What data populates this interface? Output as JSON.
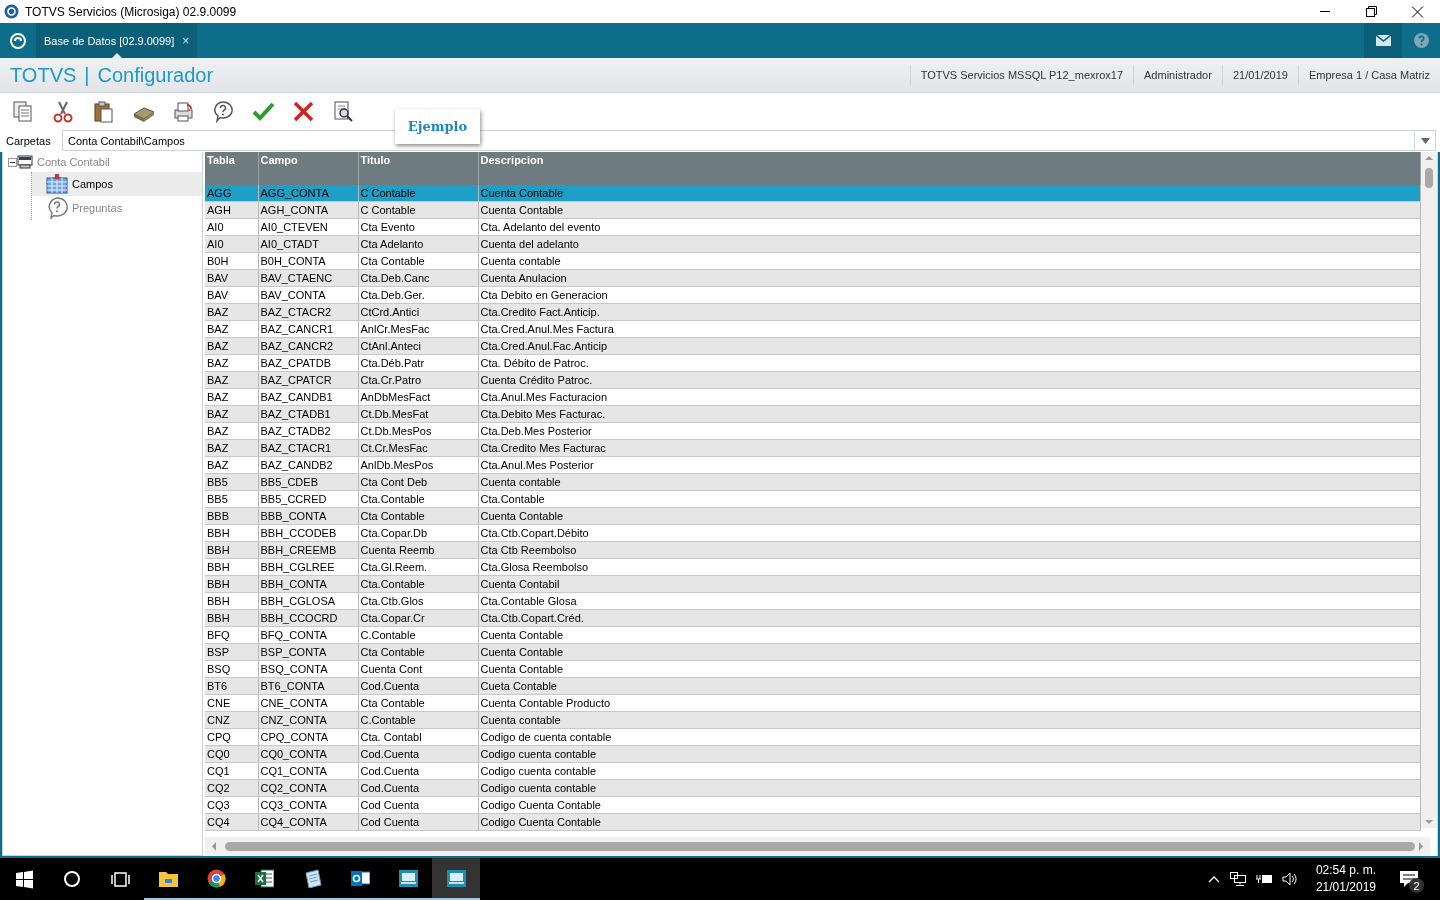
{
  "window": {
    "title": "TOTVS Servicios (Microsiga) 02.9.0099"
  },
  "tabs": [
    {
      "label": "Base de Datos [02.9.0099]",
      "close": "×",
      "selected": true
    }
  ],
  "header": {
    "product": "TOTVS",
    "module": "Configurador",
    "separator": "|",
    "info": [
      "TOTVS Servicios MSSQL P12_mexrox17",
      "Administrador",
      "21/01/2019",
      "Empresa 1 / Casa Matriz"
    ]
  },
  "tooltip": "Ejemplo",
  "folder": {
    "label": "Carpetas",
    "value": "Conta Contabil\\Campos"
  },
  "tree": [
    {
      "label": "Conta Contabil",
      "kind": "table",
      "selected": false,
      "expanded": true,
      "children": [
        {
          "label": "Campos",
          "kind": "grid",
          "selected": true
        },
        {
          "label": "Preguntas",
          "kind": "question",
          "selected": false
        }
      ]
    }
  ],
  "table": {
    "columns": [
      "Tabla",
      "Campo",
      "Titulo",
      "Descripcion"
    ],
    "rows": [
      {
        "cells": [
          "AGG",
          "AGG_CONTA",
          "C Contable",
          "Cuenta Contable"
        ],
        "selected": true
      },
      {
        "cells": [
          "AGH",
          "AGH_CONTA",
          "C Contable",
          "Cuenta Contable"
        ],
        "selected": false
      },
      {
        "cells": [
          "AI0",
          "AI0_CTEVEN",
          "Cta Evento",
          "Cta. Adelanto del evento"
        ],
        "selected": false
      },
      {
        "cells": [
          "AI0",
          "AI0_CTADT",
          "Cta Adelanto",
          "Cuenta del adelanto"
        ],
        "selected": false
      },
      {
        "cells": [
          "B0H",
          "B0H_CONTA",
          "Cta Contable",
          "Cuenta contable"
        ],
        "selected": false
      },
      {
        "cells": [
          "BAV",
          "BAV_CTAENC",
          "Cta.Deb.Canc",
          "Cuenta Anulacion"
        ],
        "selected": false
      },
      {
        "cells": [
          "BAV",
          "BAV_CONTA",
          "Cta.Deb.Ger.",
          "Cta Debito en Generacion"
        ],
        "selected": false
      },
      {
        "cells": [
          "BAZ",
          "BAZ_CTACR2",
          "CtCrd.Antici",
          "Cta.Credito Fact.Anticip."
        ],
        "selected": false
      },
      {
        "cells": [
          "BAZ",
          "BAZ_CANCR1",
          "AnlCr.MesFac",
          "Cta.Cred.Anul.Mes Factura"
        ],
        "selected": false
      },
      {
        "cells": [
          "BAZ",
          "BAZ_CANCR2",
          "CtAnl.Anteci",
          "Cta.Cred.Anul.Fac.Anticip"
        ],
        "selected": false
      },
      {
        "cells": [
          "BAZ",
          "BAZ_CPATDB",
          "Cta.Déb.Patr",
          "Cta. Débito de Patroc."
        ],
        "selected": false
      },
      {
        "cells": [
          "BAZ",
          "BAZ_CPATCR",
          "Cta.Cr.Patro",
          "Cuenta Crédito Patroc."
        ],
        "selected": false
      },
      {
        "cells": [
          "BAZ",
          "BAZ_CANDB1",
          "AnDbMesFact",
          "Cta.Anul.Mes Facturacion"
        ],
        "selected": false
      },
      {
        "cells": [
          "BAZ",
          "BAZ_CTADB1",
          "Ct.Db.MesFat",
          "Cta.Debito Mes Facturac."
        ],
        "selected": false
      },
      {
        "cells": [
          "BAZ",
          "BAZ_CTADB2",
          "Ct.Db.MesPos",
          "Cta.Deb.Mes Posterior"
        ],
        "selected": false
      },
      {
        "cells": [
          "BAZ",
          "BAZ_CTACR1",
          "Ct.Cr.MesFac",
          "Cta.Credito Mes Facturac"
        ],
        "selected": false
      },
      {
        "cells": [
          "BAZ",
          "BAZ_CANDB2",
          "AnlDb.MesPos",
          "Cta.Anul.Mes Posterior"
        ],
        "selected": false
      },
      {
        "cells": [
          "BB5",
          "BB5_CDEB",
          "Cta Cont Deb",
          "Cuenta contable"
        ],
        "selected": false
      },
      {
        "cells": [
          "BB5",
          "BB5_CCRED",
          "Cta.Contable",
          "Cta.Contable"
        ],
        "selected": false
      },
      {
        "cells": [
          "BBB",
          "BBB_CONTA",
          "Cta Contable",
          "Cuenta Contable"
        ],
        "selected": false
      },
      {
        "cells": [
          "BBH",
          "BBH_CCODEB",
          "Cta.Copar.Db",
          "Cta.Ctb.Copart.Débito"
        ],
        "selected": false
      },
      {
        "cells": [
          "BBH",
          "BBH_CREEMB",
          "Cuenta Reemb",
          "Cta Ctb Reembolso"
        ],
        "selected": false
      },
      {
        "cells": [
          "BBH",
          "BBH_CGLREE",
          "Cta.Gl.Reem.",
          "Cta.Glosa Reembolso"
        ],
        "selected": false
      },
      {
        "cells": [
          "BBH",
          "BBH_CONTA",
          "Cta.Contable",
          "Cuenta Contabil"
        ],
        "selected": false
      },
      {
        "cells": [
          "BBH",
          "BBH_CGLOSA",
          "Cta.Ctb.Glos",
          "Cta.Contable Glosa"
        ],
        "selected": false
      },
      {
        "cells": [
          "BBH",
          "BBH_CCOCRD",
          "Cta.Copar.Cr",
          "Cta.Ctb.Copart.Créd."
        ],
        "selected": false
      },
      {
        "cells": [
          "BFQ",
          "BFQ_CONTA",
          "C.Contable",
          "Cuenta Contable"
        ],
        "selected": false
      },
      {
        "cells": [
          "BSP",
          "BSP_CONTA",
          "Cta Contable",
          "Cuenta Contable"
        ],
        "selected": false
      },
      {
        "cells": [
          "BSQ",
          "BSQ_CONTA",
          "Cuenta Cont",
          "Cuenta Contable"
        ],
        "selected": false
      },
      {
        "cells": [
          "BT6",
          "BT6_CONTA",
          "Cod.Cuenta",
          "Cueta Contable"
        ],
        "selected": false
      },
      {
        "cells": [
          "CNE",
          "CNE_CONTA",
          "Cta Contable",
          "Cuenta Contable Producto"
        ],
        "selected": false
      },
      {
        "cells": [
          "CNZ",
          "CNZ_CONTA",
          "C.Contable",
          "Cuenta contable"
        ],
        "selected": false
      },
      {
        "cells": [
          "CPQ",
          "CPQ_CONTA",
          "Cta. Contabl",
          "Codigo de cuenta contable"
        ],
        "selected": false
      },
      {
        "cells": [
          "CQ0",
          "CQ0_CONTA",
          "Cod.Cuenta",
          "Codigo cuenta contable"
        ],
        "selected": false
      },
      {
        "cells": [
          "CQ1",
          "CQ1_CONTA",
          "Cod.Cuenta",
          "Codigo cuenta contable"
        ],
        "selected": false
      },
      {
        "cells": [
          "CQ2",
          "CQ2_CONTA",
          "Cod.Cuenta",
          "Codigo cuenta contable"
        ],
        "selected": false
      },
      {
        "cells": [
          "CQ3",
          "CQ3_CONTA",
          "Cod Cuenta",
          "Codigo Cuenta Contable"
        ],
        "selected": false
      },
      {
        "cells": [
          "CQ4",
          "CQ4_CONTA",
          "Cod Cuenta",
          "Codigo Cuenta Contable"
        ],
        "selected": false
      }
    ]
  },
  "taskbar": {
    "time": "02:54 p. m.",
    "date": "21/01/2019",
    "notifications": "2"
  }
}
